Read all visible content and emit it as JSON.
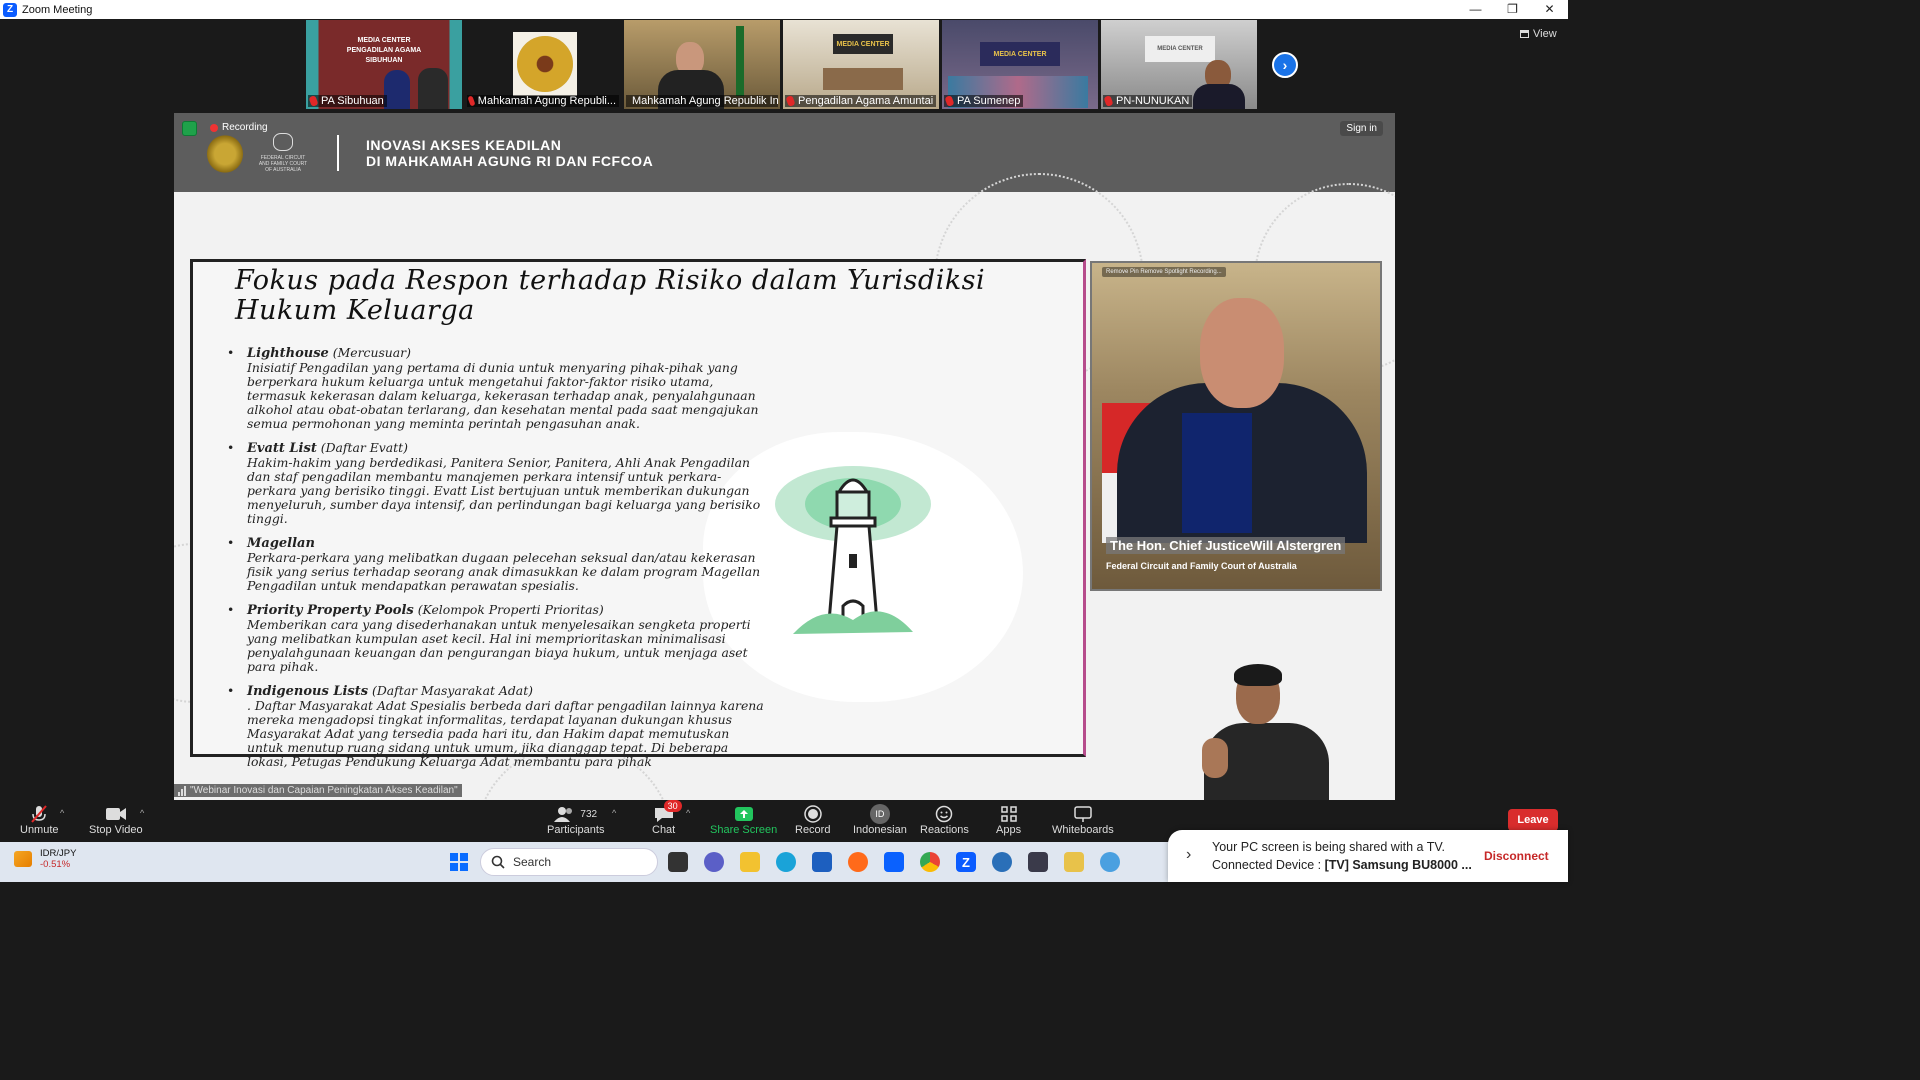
{
  "window": {
    "title": "Zoom Meeting",
    "controls": [
      "—",
      "❐",
      "✕"
    ]
  },
  "participants_strip": [
    {
      "name": "PA Sibuhuan",
      "sign": "MEDIA CENTER PENGADILAN AGAMA SIBUHUAN"
    },
    {
      "name": "Mahkamah Agung Republi...",
      "sign": ""
    },
    {
      "name": "Mahkamah Agung Republik In...",
      "sign": ""
    },
    {
      "name": "Pengadilan Agama Amuntai",
      "sign": "MEDIA CENTER"
    },
    {
      "name": "PA Sumenep",
      "sign": "MEDIA CENTER"
    },
    {
      "name": "PN-NUNUKAN",
      "sign": "MEDIA CENTER"
    }
  ],
  "view_label": "View",
  "share": {
    "recording_label": "Recording",
    "sign_in": "Sign in",
    "banner_title_line1": "INOVASI AKSES KEADILAN",
    "banner_title_line2": "DI MAHKAMAH AGUNG RI DAN FCFCOA",
    "fcfcoa_logo_text": "FEDERAL CIRCUIT AND FAMILY COURT OF AUSTRALIA",
    "slide": {
      "title_line1": "Fokus pada Respon terhadap Risiko dalam Yurisdiksi",
      "title_line2": "Hukum Keluarga",
      "items": [
        {
          "head": "Lighthouse",
          "sub": "(Mercusuar)",
          "body": "Inisiatif Pengadilan yang pertama di dunia untuk menyaring pihak-pihak yang berperkara hukum keluarga untuk mengetahui faktor-faktor risiko utama, termasuk kekerasan dalam keluarga, kekerasan terhadap anak, penyalahgunaan alkohol atau obat-obatan terlarang, dan kesehatan mental pada saat mengajukan semua permohonan yang meminta perintah pengasuhan anak."
        },
        {
          "head": "Evatt List",
          "sub": "(Daftar Evatt)",
          "body": "Hakim-hakim yang berdedikasi, Panitera Senior, Panitera, Ahli Anak Pengadilan dan staf pengadilan membantu manajemen perkara intensif untuk perkara-perkara yang berisiko tinggi. Evatt List bertujuan untuk memberikan dukungan menyeluruh, sumber daya intensif, dan perlindungan bagi keluarga yang berisiko tinggi."
        },
        {
          "head": "Magellan",
          "sub": "",
          "body": "Perkara-perkara yang melibatkan dugaan pelecehan seksual dan/atau kekerasan fisik yang serius terhadap seorang anak dimasukkan ke dalam program Magellan Pengadilan untuk mendapatkan perawatan spesialis."
        },
        {
          "head": "Priority Property Pools",
          "sub": "(Kelompok Properti Prioritas)",
          "body": "Memberikan cara yang disederhanakan untuk menyelesaikan sengketa properti yang melibatkan kumpulan aset kecil. Hal ini memprioritaskan minimalisasi penyalahgunaan keuangan dan pengurangan biaya hukum, untuk menjaga aset para pihak."
        },
        {
          "head": "Indigenous Lists",
          "sub": "(Daftar Masyarakat Adat)",
          "body": ". Daftar Masyarakat Adat Spesialis berbeda dari daftar pengadilan lainnya karena mereka mengadopsi tingkat informalitas, terdapat layanan dukungan khusus Masyarakat Adat yang tersedia pada hari itu, dan Hakim dapat memutuskan untuk menutup ruang sidang untuk umum, jika dianggap tepat. Di beberapa lokasi, Petugas Pendukung Keluarga Adat membantu para pihak"
        }
      ]
    },
    "speaker": {
      "topbar": "Remove Pin   Remove Spotlight   Recording...",
      "name": "The Hon. Chief JusticeWill Alstergren",
      "org": "Federal Circuit and Family Court of Australia"
    },
    "webinar_tag": "\"Webinar Inovasi dan Capaian Peningkatan Akses Keadilan\""
  },
  "toolbar": {
    "unmute": "Unmute",
    "stop_video": "Stop Video",
    "participants": "Participants",
    "participants_count": "732",
    "chat": "Chat",
    "chat_badge": "30",
    "share_screen": "Share Screen",
    "record": "Record",
    "language": "Indonesian",
    "language_icon": "ID",
    "reactions": "Reactions",
    "apps": "Apps",
    "whiteboards": "Whiteboards",
    "leave": "Leave"
  },
  "taskbar": {
    "stock_symbol": "IDR/JPY",
    "stock_change": "-0.51%",
    "search_placeholder": "Search"
  },
  "notification": {
    "line1": "Your PC screen is being shared with a TV.",
    "line2_prefix": "Connected Device : ",
    "line2_device": "[TV] Samsung BU8000 ...",
    "disconnect": "Disconnect"
  }
}
